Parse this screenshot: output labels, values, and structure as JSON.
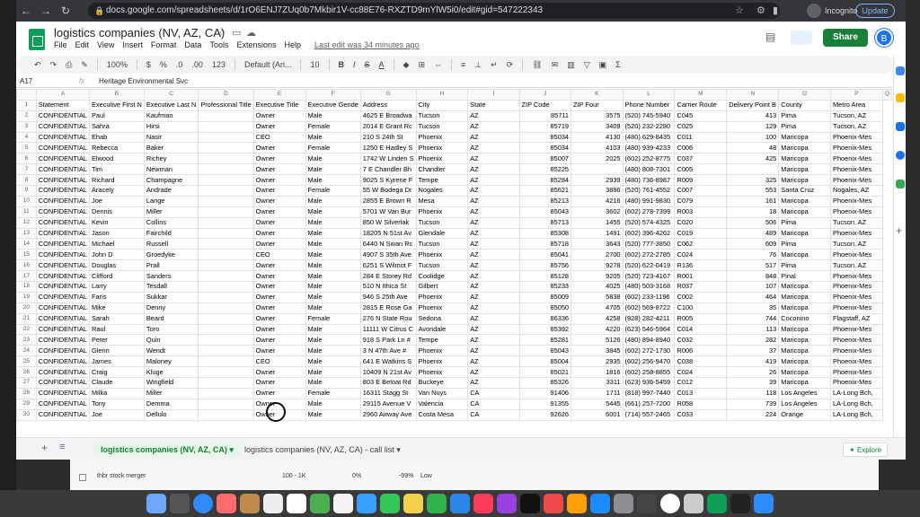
{
  "browser": {
    "url": "docs.google.com/spreadsheets/d/1rO6ENJ7ZUq0b7Mkbir1V-cc88E76-RXZTD9mYlW5i0/edit#gid=547222343",
    "profile_label": "Incognito",
    "update_label": "Update",
    "icons": [
      "back-icon",
      "forward-icon",
      "reload-icon",
      "lock-icon",
      "star-icon",
      "extension-icon",
      "sidebar-icon",
      "menu-icon"
    ]
  },
  "sheets": {
    "title": "logistics companies (NV, AZ, CA)",
    "menu": [
      "File",
      "Edit",
      "View",
      "Insert",
      "Format",
      "Data",
      "Tools",
      "Extensions",
      "Help"
    ],
    "last_edit": "Last edit was 34 minutes ago",
    "share_label": "Share",
    "user_initial": "B"
  },
  "toolbar": {
    "zoom": "100%",
    "currency": "$",
    "percent": "%",
    "decimal_dec": ".0",
    "decimal_inc": ".00",
    "number_format": "123",
    "font": "Default (Ari...",
    "font_size": "10",
    "bold": "B",
    "italic": "I",
    "strike": "S",
    "text_color": "A"
  },
  "formula_bar": {
    "cell_ref": "A17",
    "fx": "fx",
    "content": "Heritage Environmental Svc"
  },
  "columns": [
    "A",
    "B",
    "C",
    "D",
    "E",
    "F",
    "G",
    "H",
    "I",
    "J",
    "K",
    "L",
    "M",
    "N",
    "O",
    "P",
    "Q"
  ],
  "rows": [
    {
      "n": "1",
      "c": [
        "Statement",
        "Executive First N",
        "Executive Last N",
        "Professional Title",
        "Executive Title",
        "Executive Gende",
        "Address",
        "City",
        "State",
        "ZIP Code",
        "ZIP Four",
        "Phone Number",
        "Carrier Route",
        "Delivery Point B",
        "County",
        "Metro Area"
      ]
    },
    {
      "n": "2",
      "c": [
        "CONFIDENTIAL",
        "Paul",
        "Kaufman",
        "",
        "Owner",
        "Male",
        "4625 E Broadwa",
        "Tucson",
        "AZ",
        "85711",
        "3575",
        "(520) 745-5940",
        "C045",
        "413",
        "Pima",
        "Tucson, AZ"
      ]
    },
    {
      "n": "3",
      "c": [
        "CONFIDENTIAL",
        "Sahra",
        "Hirsi",
        "",
        "Owner",
        "Female",
        "2014 E Grant Rc",
        "Tucson",
        "AZ",
        "85719",
        "3409",
        "(520) 232-2280",
        "C025",
        "129",
        "Pima",
        "Tucson, AZ"
      ]
    },
    {
      "n": "4",
      "c": [
        "CONFIDENTIAL",
        "Ehab",
        "Nasir",
        "",
        "CEO",
        "Male",
        "210 S 24th St",
        "Phoenix",
        "AZ",
        "85034",
        "4130",
        "(480) 629-8435",
        "C011",
        "100",
        "Maricopa",
        "Phoenix-Mes"
      ]
    },
    {
      "n": "5",
      "c": [
        "CONFIDENTIAL",
        "Rebecca",
        "Baker",
        "",
        "Owner",
        "Female",
        "1250 E Hadley S",
        "Phoenix",
        "AZ",
        "85034",
        "4103",
        "(480) 939-4233",
        "C006",
        "48",
        "Maricopa",
        "Phoenix-Mes"
      ]
    },
    {
      "n": "6",
      "c": [
        "CONFIDENTIAL",
        "Elwood",
        "Richey",
        "",
        "Owner",
        "Male",
        "1742 W Linden S",
        "Phoenix",
        "AZ",
        "85007",
        "2025",
        "(602) 252-8775",
        "C037",
        "425",
        "Maricopa",
        "Phoenix-Mes"
      ]
    },
    {
      "n": "7",
      "c": [
        "CONFIDENTIAL",
        "Tim",
        "Newman",
        "",
        "Owner",
        "Male",
        "7 E Chandler Bh",
        "Chandler",
        "AZ",
        "85225",
        "",
        "(480) 808-7301",
        "C005",
        "",
        "Maricopa",
        "Phoenix-Mes"
      ]
    },
    {
      "n": "8",
      "c": [
        "CONFIDENTIAL",
        "Richard",
        "Champagne",
        "",
        "Owner",
        "Male",
        "9025 S Kyrene F",
        "Tempe",
        "AZ",
        "85284",
        "2939",
        "(480) 736-8987",
        "R009",
        "325",
        "Maricopa",
        "Phoenix-Mes"
      ]
    },
    {
      "n": "9",
      "c": [
        "CONFIDENTIAL",
        "Aracely",
        "Andrade",
        "",
        "Owner",
        "Female",
        "55 W Bodega Dr",
        "Nogales",
        "AZ",
        "85621",
        "3886",
        "(520) 761-4552",
        "C007",
        "553",
        "Santa Cruz",
        "Nogales, AZ"
      ]
    },
    {
      "n": "10",
      "c": [
        "CONFIDENTIAL",
        "Joe",
        "Lange",
        "",
        "Owner",
        "Male",
        "2855 E Brown R",
        "Mesa",
        "AZ",
        "85213",
        "4216",
        "(480) 991-9830",
        "C079",
        "161",
        "Maricopa",
        "Phoenix-Mes"
      ]
    },
    {
      "n": "11",
      "c": [
        "CONFIDENTIAL",
        "Dennis",
        "Miller",
        "",
        "Owner",
        "Male",
        "5701 W Van Bur",
        "Phoenix",
        "AZ",
        "85043",
        "3602",
        "(602) 278-7399",
        "R003",
        "18",
        "Maricopa",
        "Phoenix-Mes"
      ]
    },
    {
      "n": "12",
      "c": [
        "CONFIDENTIAL",
        "Kevin",
        "Collins",
        "",
        "Owner",
        "Male",
        "850 W Silverlak",
        "Tucson",
        "AZ",
        "85713",
        "1455",
        "(520) 574-4325",
        "C020",
        "506",
        "Pima",
        "Tucson, AZ"
      ]
    },
    {
      "n": "13",
      "c": [
        "CONFIDENTIAL",
        "Jason",
        "Fairchild",
        "",
        "Owner",
        "Male",
        "18205 N 51st Av",
        "Glendale",
        "AZ",
        "85308",
        "1491",
        "(602) 396-4262",
        "C019",
        "489",
        "Maricopa",
        "Phoenix-Mes"
      ]
    },
    {
      "n": "14",
      "c": [
        "CONFIDENTIAL",
        "Michael",
        "Russell",
        "",
        "Owner",
        "Male",
        "6440 N Swan Rc",
        "Tucson",
        "AZ",
        "85718",
        "3643",
        "(520) 777-3850",
        "C062",
        "609",
        "Pima",
        "Tucson, AZ"
      ]
    },
    {
      "n": "15",
      "c": [
        "CONFIDENTIAL",
        "John D",
        "Groedyke",
        "",
        "CEO",
        "Male",
        "4907 S 35th Ave",
        "Phoenix",
        "AZ",
        "85041",
        "2700",
        "(602) 272-2785",
        "C024",
        "76",
        "Maricopa",
        "Phoenix-Mes"
      ]
    },
    {
      "n": "16",
      "c": [
        "CONFIDENTIAL",
        "Douglas",
        "Prall",
        "",
        "Owner",
        "Male",
        "6251 S Wilmot F",
        "Tucson",
        "AZ",
        "85756",
        "9278",
        "(520) 622-0419",
        "R136",
        "517",
        "Pima",
        "Tucson, AZ"
      ]
    },
    {
      "n": "17",
      "c": [
        "CONFIDENTIAL",
        "Clifford",
        "Sanders",
        "",
        "Owner",
        "Male",
        "284 E Storey Rd",
        "Coolidge",
        "AZ",
        "85128",
        "9205",
        "(520) 723-4167",
        "R001",
        "848",
        "Pinal",
        "Phoenix-Mes"
      ]
    },
    {
      "n": "18",
      "c": [
        "CONFIDENTIAL",
        "Larry",
        "Tesdall",
        "",
        "Owner",
        "Male",
        "510 N Ithica St",
        "Gilbert",
        "AZ",
        "85233",
        "4025",
        "(480) 503-3168",
        "R037",
        "107",
        "Maricopa",
        "Phoenix-Mes"
      ]
    },
    {
      "n": "19",
      "c": [
        "CONFIDENTIAL",
        "Faris",
        "Sukkar",
        "",
        "Owner",
        "Male",
        "946 S 25th Ave",
        "Phoenix",
        "AZ",
        "85009",
        "5838",
        "(602) 233-1196",
        "C002",
        "464",
        "Maricopa",
        "Phoenix-Mes"
      ]
    },
    {
      "n": "20",
      "c": [
        "CONFIDENTIAL",
        "Mike",
        "Denny",
        "",
        "Owner",
        "Male",
        "2815 E Rose Ga",
        "Phoenix",
        "AZ",
        "85050",
        "4705",
        "(602) 569-8722",
        "C100",
        "35",
        "Maricopa",
        "Phoenix-Mes"
      ]
    },
    {
      "n": "21",
      "c": [
        "CONFIDENTIAL",
        "Sarah",
        "Beard",
        "",
        "Owner",
        "Female",
        "276 N State Rou",
        "Sedona",
        "AZ",
        "86336",
        "4258",
        "(928) 282-4211",
        "R005",
        "744",
        "Coconino",
        "Flagstaff, AZ"
      ]
    },
    {
      "n": "22",
      "c": [
        "CONFIDENTIAL",
        "Raul",
        "Toro",
        "",
        "Owner",
        "Male",
        "11111 W Citrus C",
        "Avondale",
        "AZ",
        "85392",
        "4220",
        "(623) 546-5964",
        "C014",
        "113",
        "Maricopa",
        "Phoenix-Mes"
      ]
    },
    {
      "n": "23",
      "c": [
        "CONFIDENTIAL",
        "Peter",
        "Quin",
        "",
        "Owner",
        "Male",
        "918 S Park Ln #",
        "Tempe",
        "AZ",
        "85281",
        "5126",
        "(480) 894-8940",
        "C032",
        "282",
        "Maricopa",
        "Phoenix-Mes"
      ]
    },
    {
      "n": "24",
      "c": [
        "CONFIDENTIAL",
        "Glenn",
        "Wendt",
        "",
        "Owner",
        "Male",
        "3 N 47th Ave #",
        "Phoenix",
        "AZ",
        "85043",
        "3845",
        "(602) 272-1730",
        "R006",
        "37",
        "Maricopa",
        "Phoenix-Mes"
      ]
    },
    {
      "n": "25",
      "c": [
        "CONFIDENTIAL",
        "James",
        "Maloney",
        "",
        "CEO",
        "Male",
        "641 E Watkins S",
        "Phoenix",
        "AZ",
        "85004",
        "2935",
        "(602) 256-9470",
        "C038",
        "419",
        "Maricopa",
        "Phoenix-Mes"
      ]
    },
    {
      "n": "26",
      "c": [
        "CONFIDENTIAL",
        "Craig",
        "Kluge",
        "",
        "Owner",
        "Male",
        "10409 N 21st Av",
        "Phoenix",
        "AZ",
        "85021",
        "1816",
        "(602) 258-8855",
        "C024",
        "26",
        "Maricopa",
        "Phoenix-Mes"
      ]
    },
    {
      "n": "27",
      "c": [
        "CONFIDENTIAL",
        "Claude",
        "Wingfield",
        "",
        "Owner",
        "Male",
        "803 E Beloat Rd",
        "Buckeye",
        "AZ",
        "85326",
        "3311",
        "(623) 936-5459",
        "C012",
        "39",
        "Maricopa",
        "Phoenix-Mes"
      ]
    },
    {
      "n": "28",
      "c": [
        "CONFIDENTIAL",
        "Milka",
        "Miller",
        "",
        "Owner",
        "Female",
        "16311 Stagg St",
        "Van Nuys",
        "CA",
        "91406",
        "1711",
        "(818) 997-7440",
        "C013",
        "118",
        "Los Angeles",
        "LA-Long Bch,"
      ]
    },
    {
      "n": "29",
      "c": [
        "CONFIDENTIAL",
        "Tony",
        "Demma",
        "",
        "Owner",
        "Male",
        "29115 Avenue V",
        "Valencia",
        "CA",
        "91355",
        "5445",
        "(661) 257-7200",
        "R058",
        "739",
        "Los Angeles",
        "LA-Long Bch,"
      ]
    },
    {
      "n": "30",
      "c": [
        "CONFIDENTIAL",
        "Joe",
        "Dellulo",
        "",
        "Owner",
        "Male",
        "2960 Airway Ave",
        "Costa Mesa",
        "CA",
        "92626",
        "6001",
        "(714) 557-2465",
        "C033",
        "224",
        "Orange",
        "LA-Long Bch,"
      ]
    }
  ],
  "tabs": {
    "active": "logistics companies (NV, AZ, CA)",
    "second": "logistics companies (NV, AZ, CA) - call list",
    "explore": "Explore"
  },
  "behind": {
    "row_label": "thbr stock merger",
    "range": "100 - 1K",
    "pct1": "0%",
    "pct2": "-99%",
    "level": "Low"
  }
}
